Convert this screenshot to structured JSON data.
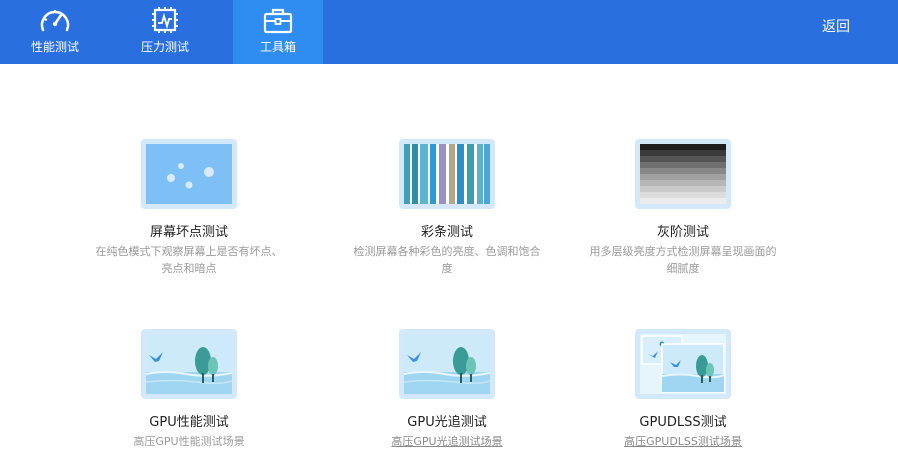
{
  "header": {
    "tabs": [
      {
        "label": "性能测试",
        "icon": "gauge-icon"
      },
      {
        "label": "压力测试",
        "icon": "chip-icon"
      },
      {
        "label": "工具箱",
        "icon": "toolbox-icon",
        "active": true
      }
    ],
    "back_label": "返回"
  },
  "tools": [
    {
      "title": "屏幕坏点测试",
      "desc": "在纯色模式下观察屏幕上是否有坏点、亮点和暗点",
      "icon": "dead-pixel-icon"
    },
    {
      "title": "彩条测试",
      "desc": "检测屏幕各种彩色的亮度、色调和饱合度",
      "icon": "color-bars-icon"
    },
    {
      "title": "灰阶测试",
      "desc": "用多层级亮度方式检测屏幕呈现画面的细腻度",
      "icon": "grayscale-icon"
    },
    {
      "title": "GPU性能测试",
      "desc": "高压GPU性能测试场景",
      "icon": "landscape-icon"
    },
    {
      "title": "GPU光追测试",
      "desc": "高压GPU光追测试场景",
      "icon": "landscape-icon"
    },
    {
      "title": "GPUDLSS测试",
      "desc": "高压GPUDLSS测试场景",
      "icon": "dlss-landscape-icon"
    }
  ],
  "colors": {
    "header_bg": "#2a6fe0",
    "active_tab_bg": "#2f8cf0"
  }
}
